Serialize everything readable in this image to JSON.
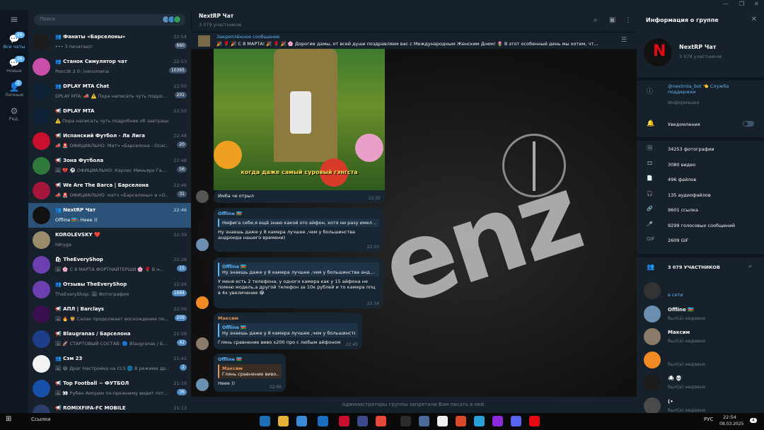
{
  "window": {
    "controls": [
      "—",
      "❐",
      "✕"
    ]
  },
  "folders": [
    {
      "label": "Все чаты",
      "badge": "26",
      "icon": "chat-bubble-icon"
    },
    {
      "label": "Новые",
      "badge": "26",
      "icon": "chat-new-icon"
    },
    {
      "label": "Личные",
      "badge": "2",
      "icon": "person-icon"
    },
    {
      "label": "Ред.",
      "badge": "",
      "icon": "edit-sliders-icon"
    }
  ],
  "search": {
    "placeholder": "Поиск"
  },
  "chats": [
    {
      "name": "👥 Фанаты «Барселоны»",
      "time": "22:54",
      "preview": "••• 3 печатают",
      "count": "660",
      "color": "#1c1c1c"
    },
    {
      "name": "👥 Станок Симулятор чат",
      "time": "22:53",
      "preview": "Ponczk 2.0: /venomena",
      "count": "10365",
      "color": "#c94fa8"
    },
    {
      "name": "👥 DPLAY MTA Chat",
      "time": "22:50",
      "preview": "DPLAY MTA: 📣 ⚠️ Пора написать чуть подро...",
      "count": "201",
      "color": "#0d2236"
    },
    {
      "name": "📢 DPLAY MTA",
      "time": "22:50",
      "preview": "⚠️ Пора написать чуть подробнее об завтрашнем...",
      "count": "",
      "color": "#0d2236"
    },
    {
      "name": "📢 Испанский Футбол - Ла Лига",
      "time": "22:48",
      "preview": "📣 🚨 ОФИЦИАЛЬНО: Матч «Барселона - Осас...",
      "count": "20",
      "color": "#c8102e"
    },
    {
      "name": "📢 Зона Футбола",
      "time": "22:48",
      "preview": "🖼 💔 ⚽ ОФИЦИАЛЬНО: Карлес Миньяро Га...",
      "count": "56",
      "color": "#2f7a3a"
    },
    {
      "name": "📢 We Are The Barca | Барселона",
      "time": "22:46",
      "preview": "📣 🚨 ОФИЦИАЛЬНО: матч «Барселоны» и «О...",
      "count": "31",
      "color": "#a4163a"
    },
    {
      "name": "👥 NextRP Чат",
      "time": "22:46",
      "preview": "Offline 🇦🇿: Неее ))",
      "count": "",
      "color": "#111111",
      "active": true
    },
    {
      "name": "KOROLEVSKY ❤️",
      "time": "22:39",
      "preview": "h8ryga",
      "count": "",
      "color": "#9a8c6a"
    },
    {
      "name": "🛍 TheEveryShop",
      "time": "22:28",
      "preview": "🖼 🌸 С 8 МАРТА ФОРТНАЙТЕРШИ 🌸 🌹 В н...",
      "count": "15",
      "color": "#6c3fb0"
    },
    {
      "name": "👥 Отзывы TheEveryShop",
      "time": "22:26",
      "preview": "TheEveryShop: 🖼 Фотография",
      "count": "1684",
      "color": "#6c3fb0"
    },
    {
      "name": "📢 АПЛ | Barclays",
      "time": "22:09",
      "preview": "🖼 🔥 🦁 Салах продолжает восхождение по...",
      "count": "209",
      "color": "#3a0f4f"
    },
    {
      "name": "📢 Blaugranas / Барселона",
      "time": "21:59",
      "preview": "🖼 🚀 СТАРТОВЫЙ СОСТАВ: 🔵 Blaugranas / Б...",
      "count": "42",
      "color": "#1d3f8a"
    },
    {
      "name": "👥 Сэм 23",
      "time": "21:41",
      "preview": "🖼 😂 Драг Настройка на CLS 🌐 В режиме др...",
      "count": "2",
      "color": "#f2f2f2"
    },
    {
      "name": "📢 Top Football ~ ФУТБОЛ",
      "time": "21:19",
      "preview": "🖼 👀 Рубен Аморим по-прежнему видит пот...",
      "count": "36",
      "color": "#1750a8"
    },
    {
      "name": "📢 ROMIXFIFA-FC MOBILE",
      "time": "21:13",
      "preview": "",
      "count": "",
      "color": "#2b3d6a"
    }
  ],
  "header": {
    "title": "NextRP Чат",
    "subtitle": "3 079 участников"
  },
  "pinned": {
    "title": "Закреплённое сообщение",
    "text": "🎉 🌹 🎉 С 8 МАРТА! 🎉 🌹 🎉 🌸 Дорогие дамы, от всей души поздравляем вас с Международным Женским Днем! 🌷 В этот особенный день мы хотим, чт..."
  },
  "media": {
    "caption": "когда даже самый суровый гэнгста"
  },
  "messages": [
    {
      "text": "Имба че отрыл",
      "time": "22:32"
    },
    {
      "author": "Offline 🇦🇿",
      "reply_text": "Нифига себе,я ещё знаю какой это айфон, хотя ни разу имел ...",
      "text": "Ну знаешь даже у 8 камера лучшее ,чем у большинства андроида нашего времени)",
      "time": "22:33"
    },
    {
      "reply_author": "Offline 🇦🇿",
      "reply_text": "Ну знаешь даже у 8 камера лучшее ,чем у большинства анд...",
      "text": "У меня есть 2 телефона, у одного камера как у 15 айфона не помню модель,а другой телефон за 10к рублей и то камера ппц в 4х увеличение 😂",
      "time": "22:34"
    },
    {
      "author": "Максим",
      "reply_author": "Offline 🇦🇿",
      "reply_text": "Ну знаешь даже у 8 камера лучшее ,чем у большинства...",
      "text": "Глянь сравнение виво х200 про с любым айфоном",
      "time": "22:45"
    },
    {
      "author": "Offline 🇦🇿",
      "reply_author": "Максим",
      "reply_text": "Глянь сравнение виво...",
      "text": "Неее ))",
      "time": "22:46"
    }
  ],
  "footer": {
    "text": "Администраторы группы запретили Вам писать в ней."
  },
  "info": {
    "title": "Информация о группе",
    "group_name": "NextRP Чат",
    "group_sub": "3 079 участников",
    "bot": "@nextmta_bot 👈 Служба поддержки",
    "bot_label": "Информация",
    "notifications": "Уведомления",
    "stats": [
      "34253 фотографии",
      "3080 видео",
      "496 файлов",
      "135 аудиофайлов",
      "9601 ссылка",
      "9299 голосовых сообщений",
      "2609 GIF"
    ],
    "members_title": "3 079 УЧАСТНИКОВ",
    "members": [
      {
        "name": "",
        "status": "в сети",
        "online": true,
        "color": "#333333"
      },
      {
        "name": "Offline 🇦🇿",
        "status": "был(а) недавно",
        "online": false,
        "color": "#6a8fb0"
      },
      {
        "name": "Максим",
        "status": "был(а) недавно",
        "online": false,
        "color": "#8a7a6a"
      },
      {
        "name": "",
        "status": "был(а) недавно",
        "online": false,
        "color": "#f08a24"
      },
      {
        "name": "🕷 💀",
        "status": "был(а) недавно",
        "online": false,
        "color": "#1c1c1c"
      },
      {
        "name": "(•",
        "status": "был(а) недавно",
        "online": false,
        "color": "#4a4a4a"
      }
    ]
  },
  "taskbar": {
    "search": "Ссылки",
    "lang": "РУС",
    "time": "22:54",
    "date": "08.03.2025",
    "notif": "4"
  }
}
